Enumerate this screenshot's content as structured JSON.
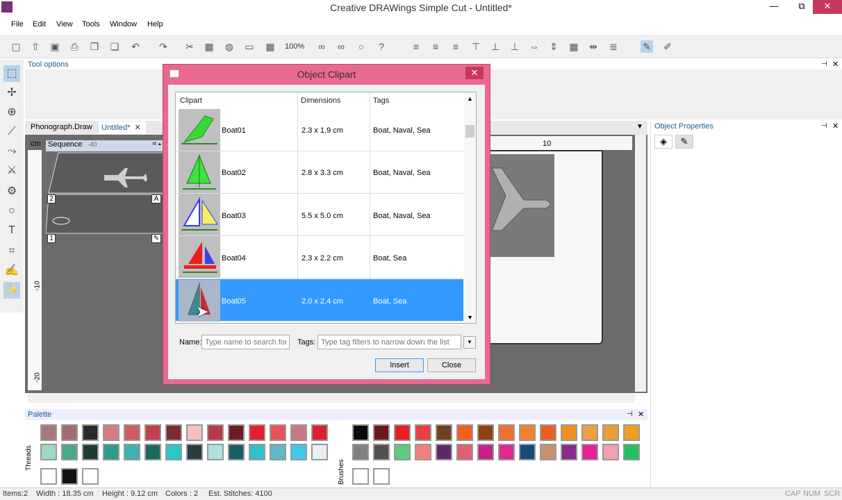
{
  "window": {
    "title": "Creative DRAWings Simple Cut - Untitled*",
    "minimize": "—",
    "restore": "⧉",
    "close": "✕"
  },
  "menu": [
    "File",
    "Edit",
    "View",
    "Tools",
    "Window",
    "Help"
  ],
  "toolbar": {
    "zoom": "100%"
  },
  "panels": {
    "tool_options": "Tool options",
    "object_properties": "Object Properties",
    "palette": "Palette",
    "threads": "Threads",
    "brushes": "Brushes",
    "sequence": "Sequence",
    "sequence_value": "-40"
  },
  "tabs": [
    {
      "label": "Phonograph.Draw"
    },
    {
      "label": "Untitled*"
    }
  ],
  "ruler": {
    "unit": "cm",
    "top_mark": "10",
    "left_marks": [
      "-10",
      "-20"
    ]
  },
  "sequence_items": [
    "2",
    "1"
  ],
  "dialog": {
    "title": "Object Clipart",
    "close": "✕",
    "columns": [
      "Clipart",
      "Dimensions",
      "Tags"
    ],
    "rows": [
      {
        "name": "Boat01",
        "dimensions": "2.3 x 1.9 cm",
        "tags": "Boat, Naval, Sea"
      },
      {
        "name": "Boat02",
        "dimensions": "2.8 x 3.3 cm",
        "tags": "Boat, Naval, Sea"
      },
      {
        "name": "Boat03",
        "dimensions": "5.5 x 5.0 cm",
        "tags": "Boat, Naval, Sea"
      },
      {
        "name": "Boat04",
        "dimensions": "2.3 x 2.2 cm",
        "tags": "Boat, Sea"
      },
      {
        "name": "Boat05",
        "dimensions": "2.0 x 2.4 cm",
        "tags": "Boat, Sea"
      }
    ],
    "selected_row": "Boat05",
    "name_label": "Name:",
    "name_placeholder": "Type name to search for",
    "tags_label": "Tags:",
    "tags_placeholder": "Type tag filters to narrow down the list",
    "insert": "Insert",
    "close_button": "Close"
  },
  "palette_colors": {
    "threads_row1": [
      "#a8787a",
      "#a36c6c",
      "#2a2a2a",
      "#d47c80",
      "#d05a62",
      "#c2404a",
      "#7a2c33",
      "#f4c0c4",
      "#b83a44",
      "#6e1c24",
      "#e4202c",
      "#e8505c",
      "#c87880",
      "#dc2030"
    ],
    "threads_row2": [
      "#a0d8c0",
      "#4aa88a",
      "#1c3c34",
      "#2a9c8c",
      "#3ab4b0",
      "#1a6a60",
      "#28c8c8",
      "#2a3c3c",
      "#b0e0e0",
      "#1a5c64",
      "#30c0cc",
      "#60b8c8",
      "#40c8e8",
      "#e8f0f0"
    ],
    "brushes_row1": [
      "#0a0a0a",
      "#6a1a1a",
      "#e82020",
      "#e84040",
      "#704020",
      "#f06020",
      "#904010",
      "#f07030",
      "#f08030",
      "#e86020",
      "#f09020",
      "#f0a040",
      "#e8a030",
      "#f0a020"
    ],
    "brushes_row2": [
      "#808080",
      "#505050",
      "#60c880",
      "#f08080",
      "#5a2a6a",
      "#e06070",
      "#c82088",
      "#e02890",
      "#1a4a7a",
      "#c89070",
      "#8a2a8a",
      "#e82090",
      "#f0a0b0",
      "#20c060"
    ]
  },
  "status": {
    "items": "Items:2",
    "width": "Width : 18.35 cm",
    "height": "Height : 9.12 cm",
    "colors": "Colors : 2",
    "stitches": "Est. Stitches: 4100",
    "cap": "CAP",
    "num": "NUM",
    "scr": "SCR"
  }
}
